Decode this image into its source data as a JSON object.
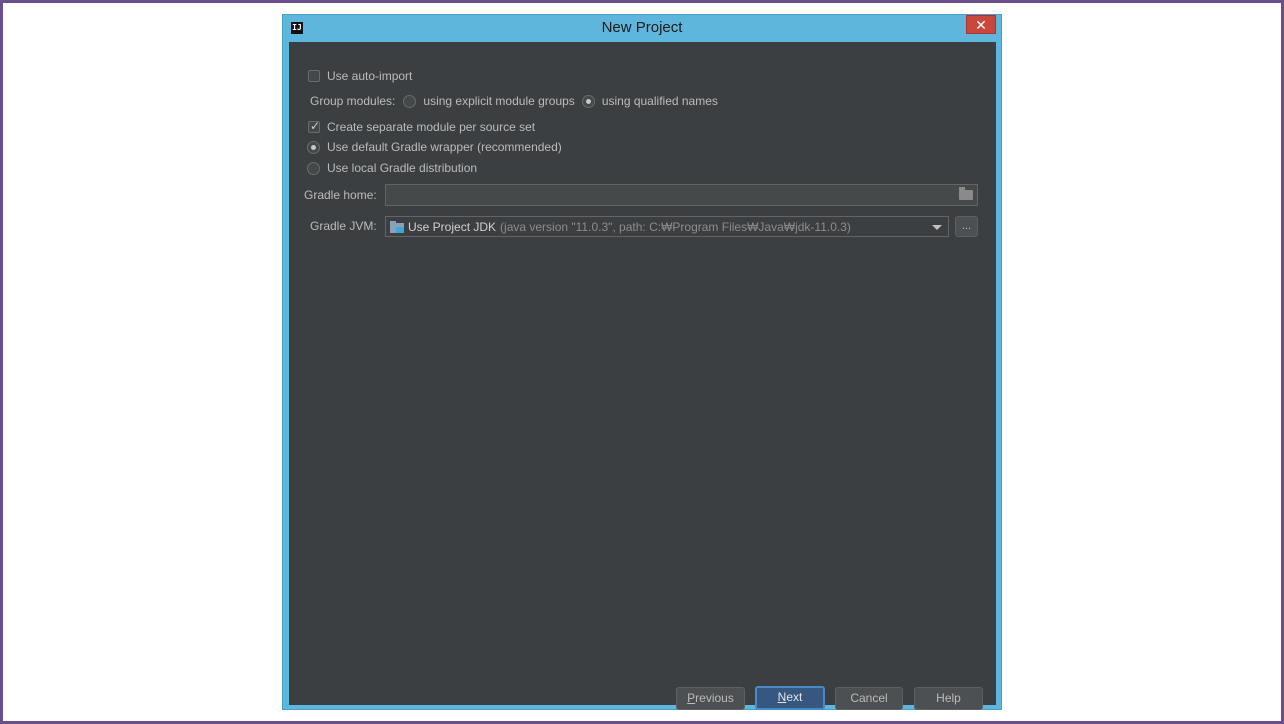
{
  "window": {
    "title": "New Project",
    "app_icon": "intellij-icon",
    "close_glyph": "✕"
  },
  "options": {
    "auto_import": {
      "label": "Use auto-import",
      "checked": false
    },
    "group_modules": {
      "label": "Group modules:",
      "explicit": {
        "label": "using explicit module groups",
        "selected": false
      },
      "qualified": {
        "label": "using qualified names",
        "selected": true
      }
    },
    "separate_module": {
      "label": "Create separate module per source set",
      "checked": true
    },
    "default_wrapper": {
      "label": "Use default Gradle wrapper (recommended)",
      "selected": true
    },
    "local_distribution": {
      "label": "Use local Gradle distribution",
      "selected": false
    }
  },
  "gradle_home": {
    "label": "Gradle home:",
    "value": ""
  },
  "gradle_jvm": {
    "label": "Gradle JVM:",
    "selected_main": "Use Project JDK",
    "selected_detail": "(java version \"11.0.3\", path: C:₩Program Files₩Java₩jdk-11.0.3)",
    "more_label": "..."
  },
  "buttons": {
    "previous": {
      "mnemonic": "P",
      "rest": "revious"
    },
    "next": {
      "mnemonic": "N",
      "rest": "ext"
    },
    "cancel": "Cancel",
    "help": "Help"
  },
  "colors": {
    "window_frame": "#5fb6dd",
    "content_bg": "#3c3f41",
    "close_bg": "#c9483e",
    "primary_button": "#365880",
    "outer_border": "#6b4f8c"
  }
}
